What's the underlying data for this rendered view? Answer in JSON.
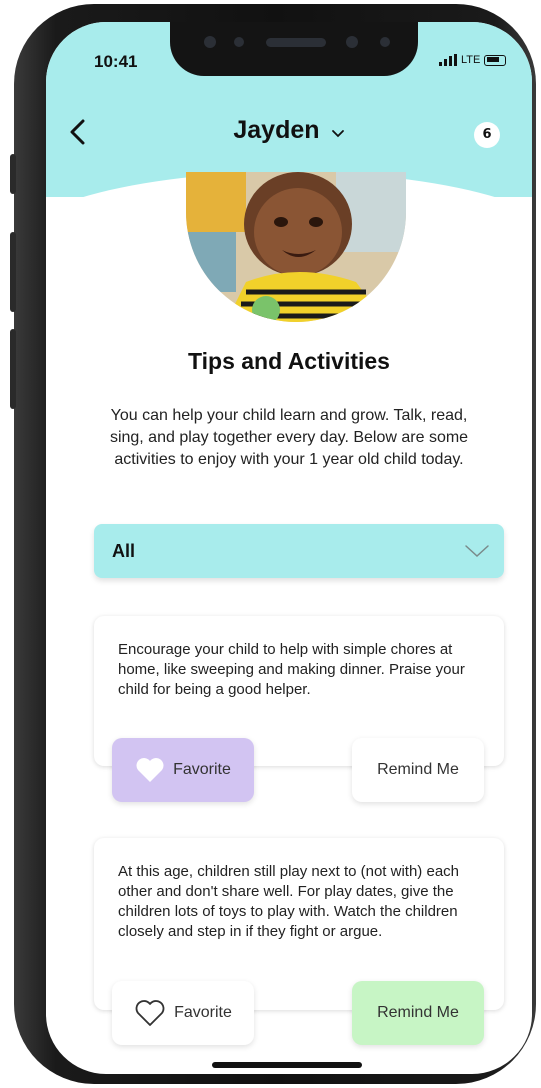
{
  "status_bar": {
    "time": "10:41",
    "network": "LTE"
  },
  "header": {
    "title": "Jayden",
    "badge_count": "6"
  },
  "content": {
    "heading": "Tips and Activities",
    "intro": "You can help your child learn and grow. Talk, read, sing, and play together every day. Below are some activities to enjoy with your 1 year old child today."
  },
  "filter": {
    "selected": "All"
  },
  "cards": [
    {
      "text": "Encourage your child to help with simple chores at home, like sweeping and making dinner. Praise your child for being a good helper.",
      "favorite_label": "Favorite",
      "remind_label": "Remind Me",
      "favorited": true,
      "reminded": false
    },
    {
      "text": "At this age, children still play next to (not with) each other and don't share well. For play dates, give the children lots of toys to play with. Watch the children closely and step in if they fight or argue.",
      "favorite_label": "Favorite",
      "remind_label": "Remind Me",
      "favorited": false,
      "reminded": true
    }
  ],
  "colors": {
    "header_teal": "#a8ecec",
    "favorite_purple": "#d2c4f2",
    "remind_green": "#c7f5c5"
  }
}
